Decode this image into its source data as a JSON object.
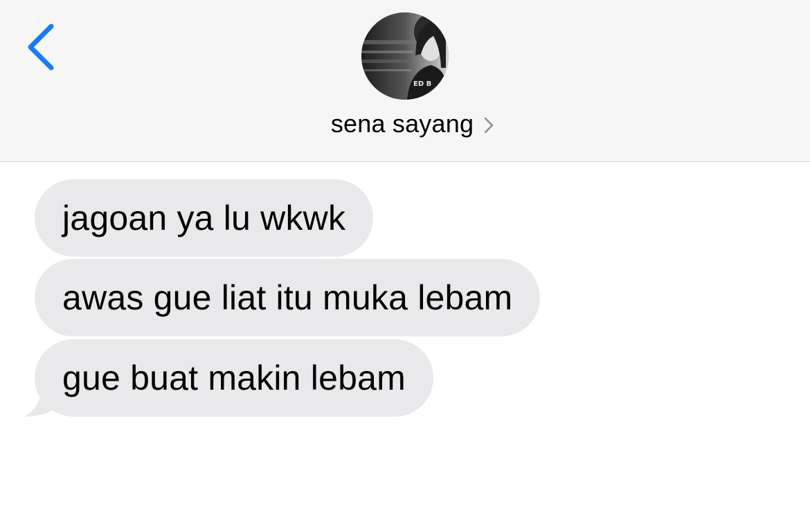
{
  "header": {
    "back_icon": "chevron-left-icon",
    "contact": {
      "name": "sena sayang",
      "avatar": "contact-photo",
      "disclosure_icon": "chevron-right-icon"
    }
  },
  "messages": [
    {
      "direction": "incoming",
      "text": "jagoan ya lu wkwk"
    },
    {
      "direction": "incoming",
      "text": "awas gue liat itu muka lebam"
    },
    {
      "direction": "incoming",
      "text": "gue buat makin lebam"
    }
  ],
  "colors": {
    "accent": "#1a7cf5",
    "incoming_bubble": "#e9e9eb",
    "header_background": "#f6f6f7",
    "chevron_gray": "#8e8e93"
  }
}
